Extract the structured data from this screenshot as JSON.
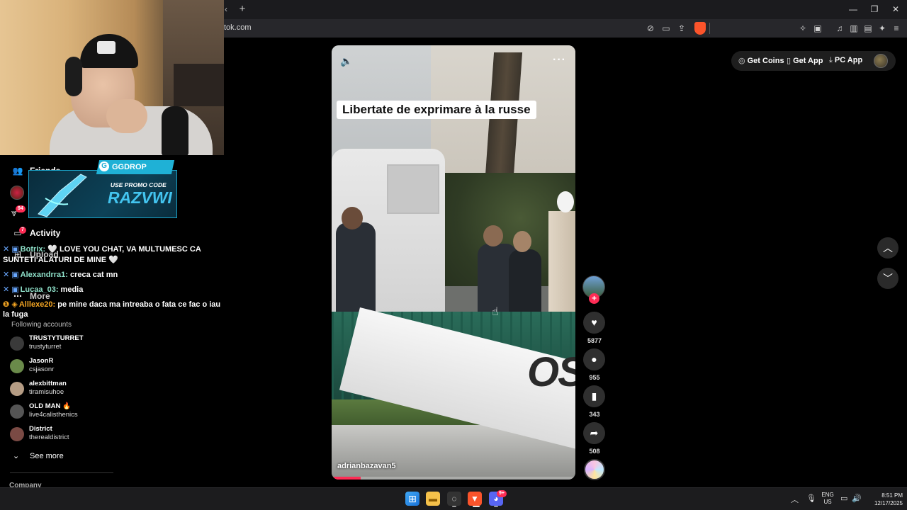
{
  "browser": {
    "url": "tok.com",
    "new_tab_symbol": "+",
    "tab_close_symbol": "‹"
  },
  "top_actions": {
    "get_coins": "Get Coins",
    "get_app": "Get App",
    "pc_app": "PC App"
  },
  "sidebar": {
    "nav": {
      "friends": "Friends",
      "activity": "Activity",
      "upload": "Upload",
      "more": "More",
      "notif_badge": "94",
      "activity_badge": "7"
    },
    "following_title": "Following accounts",
    "accounts": [
      {
        "name": "TRUSTYTURRET",
        "handle": "trustyturret"
      },
      {
        "name": "JasonR",
        "handle": "csjasonr"
      },
      {
        "name": "alexbittman",
        "handle": "tiramisuhoe"
      },
      {
        "name": "OLD MAN 🔥",
        "handle": "live4calisthenics"
      },
      {
        "name": "District",
        "handle": "therealdistrict"
      }
    ],
    "see_more": "See more",
    "company": "Company"
  },
  "chat": [
    {
      "user": "Botrix:",
      "text": "🤍 LOVE YOU CHAT, VA MULTUMESC CA"
    },
    {
      "user": "",
      "text": "SUNTETI ALATURI DE MINE 🤍"
    },
    {
      "user": "Alexandrra1:",
      "text": "creca cat mn"
    },
    {
      "user": "Lucaa_03:",
      "text": "media"
    },
    {
      "user": "Alllexe20:",
      "text": "pe mine daca ma intreaba o fata ce fac o iau"
    },
    {
      "user": "",
      "text": "la fuga"
    }
  ],
  "promo": {
    "brand": "GGDROP",
    "line1": "USE PROMO CODE",
    "code": "RAZVWI"
  },
  "video": {
    "caption": "Libertate de exprimare à la russe",
    "author": "adrianbazavan5",
    "banner_text": "OSCI",
    "progress": 0.12
  },
  "actions": {
    "likes": "5877",
    "comments": "955",
    "saves": "343",
    "shares": "508"
  },
  "taskbar": {
    "lang_line1": "ENG",
    "lang_line2": "US",
    "time": "8:51 PM",
    "date": "12/17/2025",
    "discord_badge": "9+"
  },
  "colors": {
    "accent": "#fe2c55",
    "promo_blue": "#1fb1d6",
    "chat_user": "#8ee0c9"
  }
}
